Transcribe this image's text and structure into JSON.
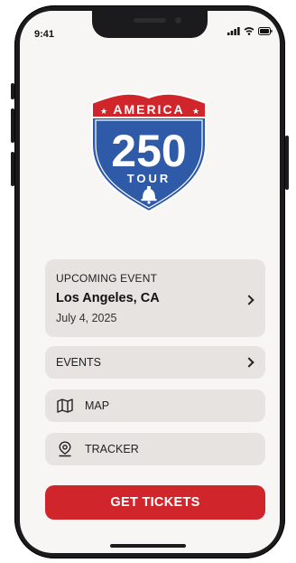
{
  "status_bar": {
    "time": "9:41"
  },
  "logo": {
    "banner_text": "AMERICA",
    "number": "250",
    "subtitle": "TOUR"
  },
  "upcoming": {
    "kicker": "UPCOMING EVENT",
    "city": "Los Angeles, CA",
    "date": "July 4, 2025"
  },
  "menu": [
    {
      "label": "EVENTS",
      "icon": "chevron-right-icon"
    },
    {
      "label": "MAP",
      "icon": "map-icon"
    },
    {
      "label": "TRACKER",
      "icon": "location-pin-icon"
    }
  ],
  "cta": {
    "label": "GET TICKETS"
  },
  "colors": {
    "brand_red": "#d0262b",
    "brand_blue": "#2e5aa8",
    "card_bg": "#e6e3e1"
  }
}
